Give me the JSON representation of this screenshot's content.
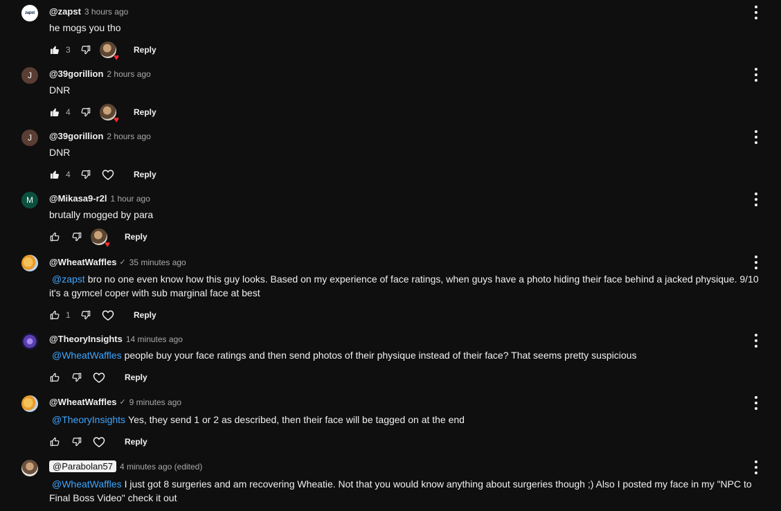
{
  "comments": [
    {
      "author": "@zapst",
      "time": "3 hours ago",
      "text": "he mogs you tho",
      "likes": "3",
      "avatar_initial": "zapst",
      "heart": true
    },
    {
      "author": "@39gorillion",
      "time": "2 hours ago",
      "text": "DNR",
      "likes": "4",
      "avatar_initial": "J",
      "heart": true
    },
    {
      "author": "@39gorillion",
      "time": "2 hours ago",
      "text": "DNR",
      "likes": "4",
      "avatar_initial": "J",
      "heart": false
    },
    {
      "author": "@Mikasa9-r2l",
      "time": "1 hour ago",
      "text": "brutally mogged by para",
      "likes": "",
      "avatar_initial": "M",
      "heart": true
    },
    {
      "author": "@WheatWaffles",
      "verified": "✓",
      "time": "35 minutes ago",
      "mention": "@zapst",
      "text": "bro no one even know how this guy looks. Based on my experience of face ratings, when guys have a photo hiding their face behind a jacked physique. 9/10 it's a gymcel coper with sub marginal face at best",
      "likes": "1",
      "heart": false
    },
    {
      "author": "@TheoryInsights",
      "time": "14 minutes ago",
      "mention": "@WheatWaffles",
      "text": "people buy your face ratings and then send photos of their physique instead of their face? That seems pretty suspicious",
      "likes": "",
      "heart": false
    },
    {
      "author": "@WheatWaffles",
      "verified": "✓",
      "time": "9 minutes ago",
      "mention": "@TheoryInsights",
      "text": "Yes, they send 1 or 2 as described, then their face will be tagged on at the end",
      "likes": "",
      "heart": false
    },
    {
      "author": "@Parabolan57",
      "time": "4 minutes ago (edited)",
      "mention": "@WheatWaffles",
      "text": "I just got 8 surgeries and am recovering Wheatie. Not that you would know anything about surgeries though ;) Also I posted my face in my \"NPC to Final Boss Video\" check it out"
    }
  ],
  "labels": {
    "reply": "Reply"
  },
  "icons": {
    "like": "thumbs-up-icon",
    "dislike": "thumbs-down-icon",
    "heart": "heart-icon",
    "menu": "more-vert-icon"
  },
  "colors": {
    "background": "#0f0f0f",
    "mention": "#3ea6ff",
    "secondary_text": "#aaaaaa",
    "heart_badge": "#ff2d2d"
  }
}
